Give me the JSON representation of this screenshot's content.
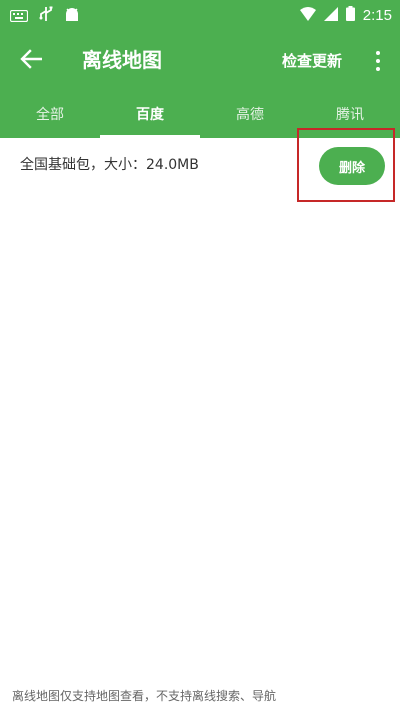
{
  "status_bar": {
    "time": "2:15",
    "icons": [
      "keyboard-icon",
      "usb-icon",
      "android-icon",
      "wifi-icon",
      "signal-icon",
      "battery-icon"
    ]
  },
  "toolbar": {
    "back_icon": "back-arrow-icon",
    "title": "离线地图",
    "check_update": "检查更新",
    "more_icon": "more-vert-icon"
  },
  "tabs": [
    {
      "label": "全部",
      "active": false
    },
    {
      "label": "百度",
      "active": true
    },
    {
      "label": "高德",
      "active": false
    },
    {
      "label": "腾讯",
      "active": false
    }
  ],
  "package": {
    "label": "全国基础包，大小：24.0MB",
    "delete_label": "删除"
  },
  "footer_note": "离线地图仅支持地图查看，不支持离线搜索、导航",
  "colors": {
    "primary": "#4caf50",
    "highlight": "#c62828",
    "text": "#333333"
  }
}
